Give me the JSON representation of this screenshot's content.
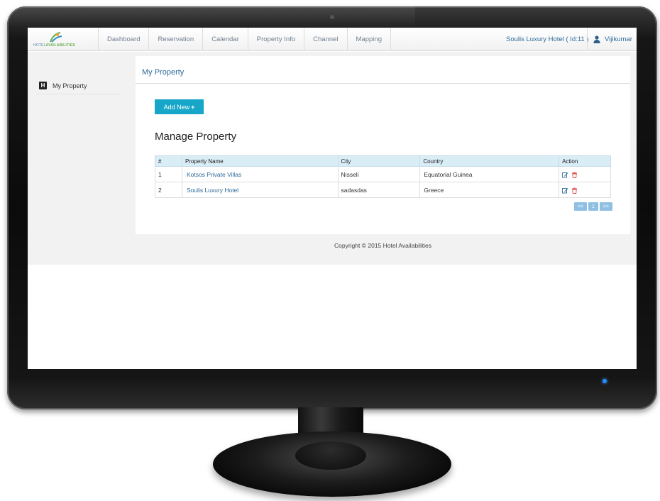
{
  "app": {
    "logo_text_1": "HOTEL",
    "logo_text_2": "AVAILABILITIES"
  },
  "nav": {
    "items": [
      {
        "label": "Dashboard"
      },
      {
        "label": "Reservation"
      },
      {
        "label": "Calendar"
      },
      {
        "label": "Property Info"
      },
      {
        "label": "Channel"
      },
      {
        "label": "Mapping"
      }
    ],
    "hotel": "Soulis Luxury Hotel ( Id:11 )",
    "user": "Vijikumar"
  },
  "sidebar": {
    "items": [
      {
        "label": "My Property",
        "icon": "hotel-icon"
      }
    ]
  },
  "main": {
    "page_title": "My Property",
    "add_button": "Add New",
    "add_icon": "+",
    "section_title": "Manage Property",
    "table": {
      "headers": [
        "#",
        "Property Name",
        "City",
        "Country",
        "Action"
      ],
      "rows": [
        {
          "num": "1",
          "name": "Kotsos Private Villas",
          "city": "Nisseli",
          "country": "Equatorial Guinea"
        },
        {
          "num": "2",
          "name": "Soulis Luxury Hotel",
          "city": "sadasdas",
          "country": "Greece"
        }
      ]
    },
    "pagination": {
      "prev": "<<",
      "page": "1",
      "next": ">>"
    }
  },
  "footer": {
    "text": "Copyright © 2015 Hotel Availabilities"
  },
  "colors": {
    "accent": "#17a6c8",
    "link": "#2d6a9a",
    "table_header": "#d9edf7",
    "pager": "#8fc0e4",
    "delete": "#d9534f",
    "power_led": "#1f8fff"
  }
}
